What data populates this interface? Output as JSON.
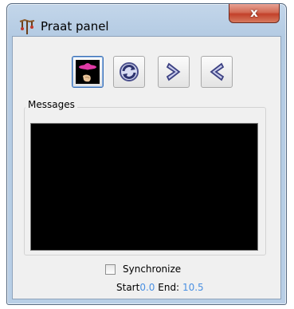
{
  "window": {
    "title": "Praat panel",
    "close_label": "x"
  },
  "toolbar": {
    "buttons": [
      {
        "name": "speaker",
        "icon": "speaker-icon"
      },
      {
        "name": "refresh",
        "icon": "refresh-icon"
      },
      {
        "name": "next",
        "icon": "chevron-right-icon"
      },
      {
        "name": "previous",
        "icon": "chevron-left-icon"
      }
    ]
  },
  "messages": {
    "label": "Messages"
  },
  "synchronize": {
    "label": "Synchronize",
    "checked": false
  },
  "range": {
    "start_label": "Start",
    "start_value": "0.0",
    "end_label": "End:",
    "end_value": "10.5"
  },
  "colors": {
    "value_text": "#4a90e2",
    "messages_bg": "#000000",
    "close_button": "#c2412a"
  }
}
